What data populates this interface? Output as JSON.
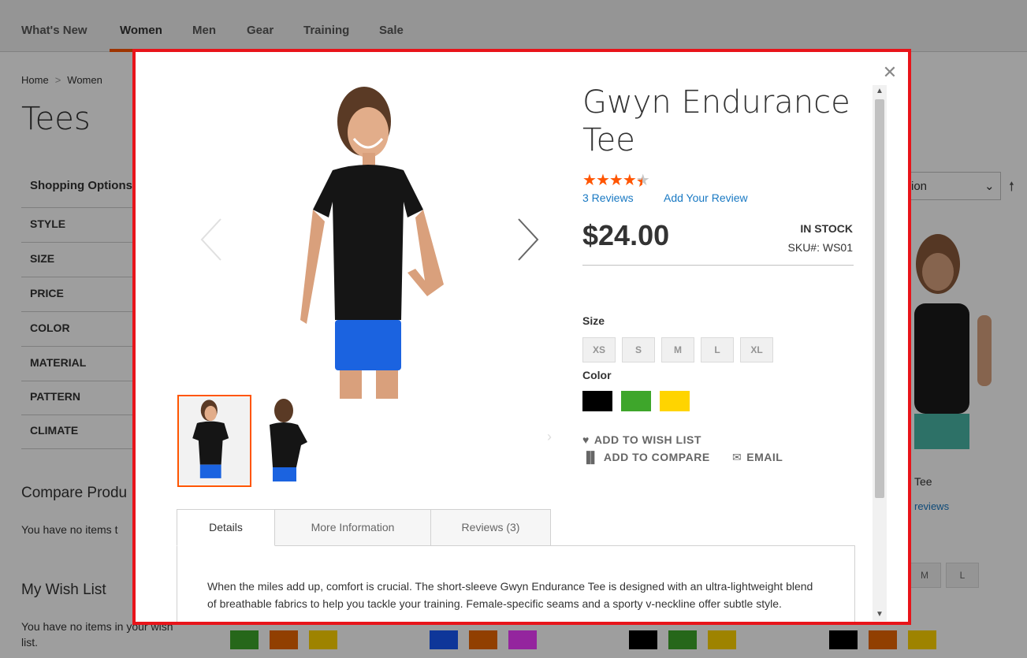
{
  "nav": {
    "items": [
      "What's New",
      "Women",
      "Men",
      "Gear",
      "Training",
      "Sale"
    ],
    "active": "Women"
  },
  "breadcrumb": {
    "home": "Home",
    "separator": ">",
    "women": "Women"
  },
  "page_title": "Tees",
  "sidebar": {
    "shopping_options": "Shopping Options",
    "filters": [
      "STYLE",
      "SIZE",
      "PRICE",
      "COLOR",
      "MATERIAL",
      "PATTERN",
      "CLIMATE"
    ],
    "compare_title": "Compare Produ",
    "compare_text": "You have no items t",
    "wishlist_title": "My Wish List",
    "wishlist_text_1": "You have no items in your wish",
    "wishlist_text_2": "list."
  },
  "toolbar": {
    "sorter_value": "sition"
  },
  "background_product": {
    "name": "Tee",
    "reviews": "reviews",
    "sizes": [
      "M",
      "L"
    ]
  },
  "modal": {
    "product_name": "Gwyn Endurance Tee",
    "rating": {
      "filled": 4,
      "half": 1,
      "total": 5
    },
    "reviews_link": "3 Reviews",
    "add_review_link": "Add Your Review",
    "price": "$24.00",
    "stock": "IN STOCK",
    "sku": "SKU#:  WS01",
    "size_label": "Size",
    "sizes": [
      "XS",
      "S",
      "M",
      "L",
      "XL"
    ],
    "color_label": "Color",
    "colors": [
      "#000000",
      "#3ea62b",
      "#ffd400"
    ],
    "actions": {
      "wishlist": "ADD TO WISH LIST",
      "compare": "ADD TO COMPARE",
      "email": "EMAIL"
    },
    "tabs": [
      "Details",
      "More Information",
      "Reviews (3)"
    ],
    "active_tab": "Details",
    "description": "When the miles add up, comfort is crucial. The short-sleeve Gwyn Endurance Tee is designed with an ultra-lightweight blend of breathable fabrics to help you tackle your training. Female-specific seams and a sporty v-neckline offer subtle style."
  },
  "colors": {
    "accent": "#ff5501",
    "link": "#1979c3",
    "modal_border": "#e8141a"
  }
}
